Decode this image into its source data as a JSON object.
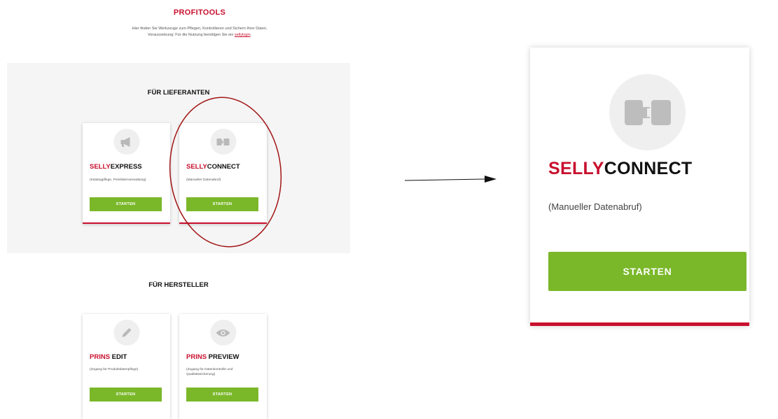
{
  "header": {
    "title": "PROFITOOLS",
    "intro_line1": "Hier finden Sie Werkzeuge zum Pflegen, Kontrollieren und Sichern Ihrer Daten.",
    "intro_line2_prefix": "Voraussetzung: Für die Nutzung benötigen Sie ein ",
    "intro_link": "sellylogin",
    "intro_line2_suffix": "."
  },
  "suppliers": {
    "title": "FÜR LIEFERANTEN",
    "cards": [
      {
        "brand": "SELLY",
        "product": "EXPRESS",
        "desc": "(Katalogpflege, Preislistenverwaltung)",
        "button": "STARTEN",
        "icon": "megaphone-icon"
      },
      {
        "brand": "SELLY",
        "product": "CONNECT",
        "desc": "(Manueller Datenabruf)",
        "button": "STARTEN",
        "icon": "puzzle-connector-icon"
      }
    ]
  },
  "manufacturers": {
    "title": "FÜR HERSTELLER",
    "cards": [
      {
        "brand": "PRINS",
        "product": " EDIT",
        "desc": "(Zugang für Produktdatenpflege)",
        "button": "STARTEN",
        "icon": "pencil-icon"
      },
      {
        "brand": "PRINS",
        "product": " PREVIEW",
        "desc": "(Zugang für Datenkontrolle und Qualitätssicherung)",
        "button": "STARTEN",
        "icon": "eye-icon"
      }
    ]
  },
  "zoom": {
    "brand": "SELLY",
    "product": "CONNECT",
    "desc": "(Manueller Datenabruf)",
    "button": "STARTEN",
    "icon": "puzzle-connector-icon"
  },
  "colors": {
    "brand_red": "#c8102e",
    "button_green": "#7ab829",
    "annotation_red": "#a31515",
    "band_gray": "#f5f5f5"
  }
}
